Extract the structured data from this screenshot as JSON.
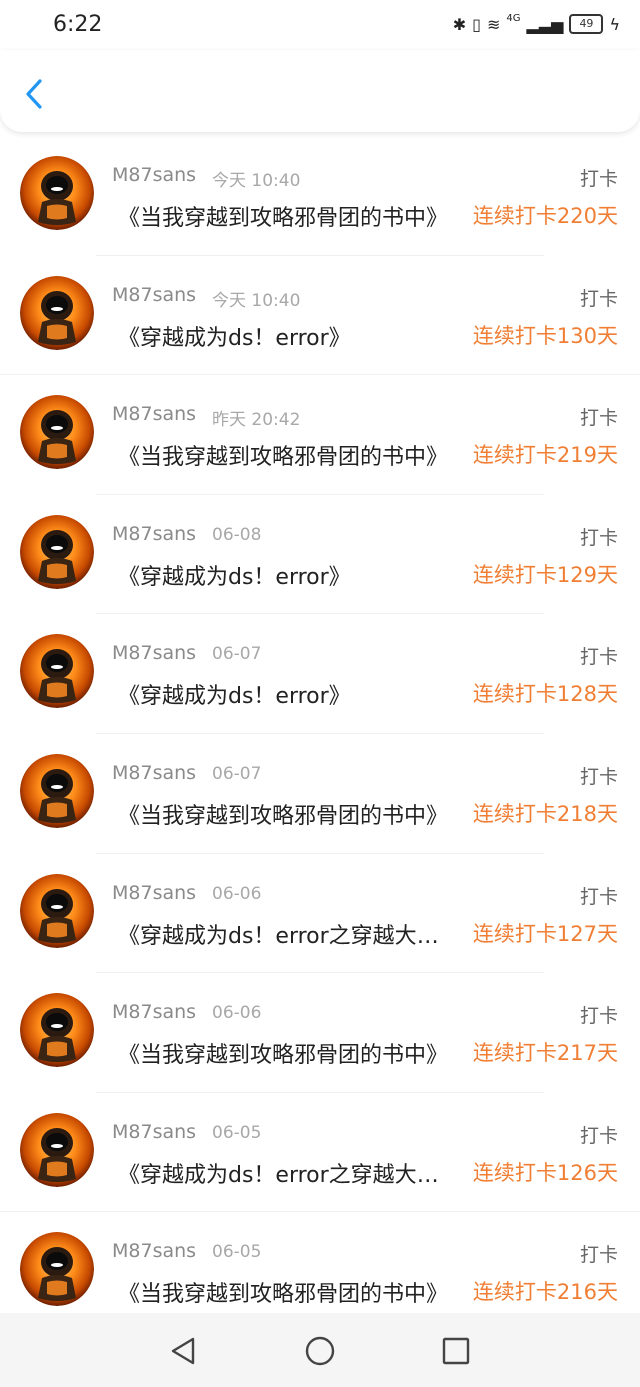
{
  "status": {
    "time": "6:22",
    "network": "4G",
    "battery": "49",
    "icons": [
      "bluetooth-icon",
      "vibrate-icon",
      "wifi-icon",
      "signal-icon",
      "battery-icon",
      "charging-icon"
    ]
  },
  "header": {
    "back_icon": "back-chevron-icon",
    "accent_color": "#2196f3"
  },
  "colors": {
    "streak": "#f07f35",
    "avatar_orange": "#ff8c1a"
  },
  "items": [
    {
      "user": "M87sans",
      "time": "今天 10:40",
      "action": "打卡",
      "title": "《当我穿越到攻略邪骨团的书中》",
      "streak": "连续打卡220天"
    },
    {
      "user": "M87sans",
      "time": "今天 10:40",
      "action": "打卡",
      "title": "《穿越成为ds！error》",
      "streak": "连续打卡130天"
    },
    {
      "user": "M87sans",
      "time": "昨天 20:42",
      "action": "打卡",
      "title": "《当我穿越到攻略邪骨团的书中》",
      "streak": "连续打卡219天"
    },
    {
      "user": "M87sans",
      "time": "06-08",
      "action": "打卡",
      "title": "《穿越成为ds！error》",
      "streak": "连续打卡129天"
    },
    {
      "user": "M87sans",
      "time": "06-07",
      "action": "打卡",
      "title": "《穿越成为ds！error》",
      "streak": "连续打卡128天"
    },
    {
      "user": "M87sans",
      "time": "06-07",
      "action": "打卡",
      "title": "《当我穿越到攻略邪骨团的书中》",
      "streak": "连续打卡218天"
    },
    {
      "user": "M87sans",
      "time": "06-06",
      "action": "打卡",
      "title": "《穿越成为ds！error之穿越大冒险》",
      "streak": "连续打卡127天"
    },
    {
      "user": "M87sans",
      "time": "06-06",
      "action": "打卡",
      "title": "《当我穿越到攻略邪骨团的书中》",
      "streak": "连续打卡217天"
    },
    {
      "user": "M87sans",
      "time": "06-05",
      "action": "打卡",
      "title": "《穿越成为ds！error之穿越大冒险》",
      "streak": "连续打卡126天"
    },
    {
      "user": "M87sans",
      "time": "06-05",
      "action": "打卡",
      "title": "《当我穿越到攻略邪骨团的书中》",
      "streak": "连续打卡216天"
    }
  ],
  "navbar": {
    "buttons": [
      "back-triangle-icon",
      "home-circle-icon",
      "recents-square-icon"
    ]
  }
}
